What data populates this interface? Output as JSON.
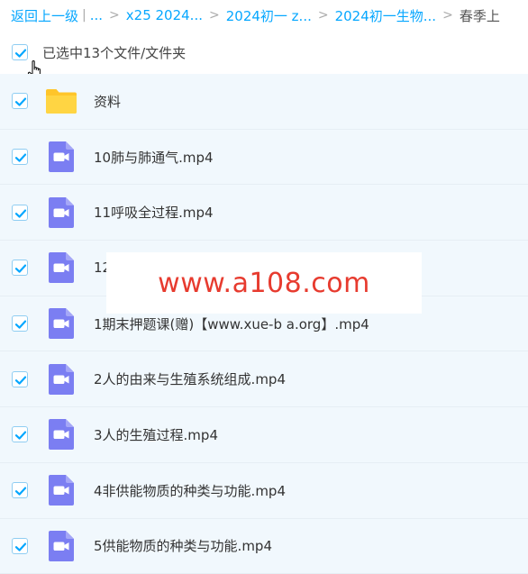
{
  "breadcrumb": {
    "back": "返回上一级",
    "pipe": "|",
    "more": "...",
    "items": [
      "x25 2024...",
      "2024初一 z...",
      "2024初一生物..."
    ],
    "current": "春季上",
    "sep": ">"
  },
  "selection": {
    "label": "已选中13个文件/文件夹",
    "checked": true
  },
  "files": [
    {
      "name": "资料",
      "type": "folder",
      "checked": true
    },
    {
      "name": "10肺与肺通气.mp4",
      "type": "video",
      "checked": true
    },
    {
      "name": "11呼吸全过程.mp4",
      "type": "video",
      "checked": true
    },
    {
      "name": "12",
      "type": "video",
      "checked": true
    },
    {
      "name": "1期末押题课(赠)【www.xue-b a.org】.mp4",
      "type": "video",
      "checked": true
    },
    {
      "name": "2人的由来与生殖系统组成.mp4",
      "type": "video",
      "checked": true
    },
    {
      "name": "3人的生殖过程.mp4",
      "type": "video",
      "checked": true
    },
    {
      "name": "4非供能物质的种类与功能.mp4",
      "type": "video",
      "checked": true
    },
    {
      "name": "5供能物质的种类与功能.mp4",
      "type": "video",
      "checked": true
    }
  ],
  "watermark": "www.a108.com",
  "colors": {
    "accent": "#06a7ff",
    "row_bg": "#f1f8fd",
    "folder": "#ffcf3f",
    "video": "#7b7ef2",
    "watermark": "#e73b2f"
  },
  "icons": {
    "folder": "folder-icon",
    "video": "video-file-icon",
    "check": "check-icon",
    "cursor": "hand-pointer-icon"
  }
}
